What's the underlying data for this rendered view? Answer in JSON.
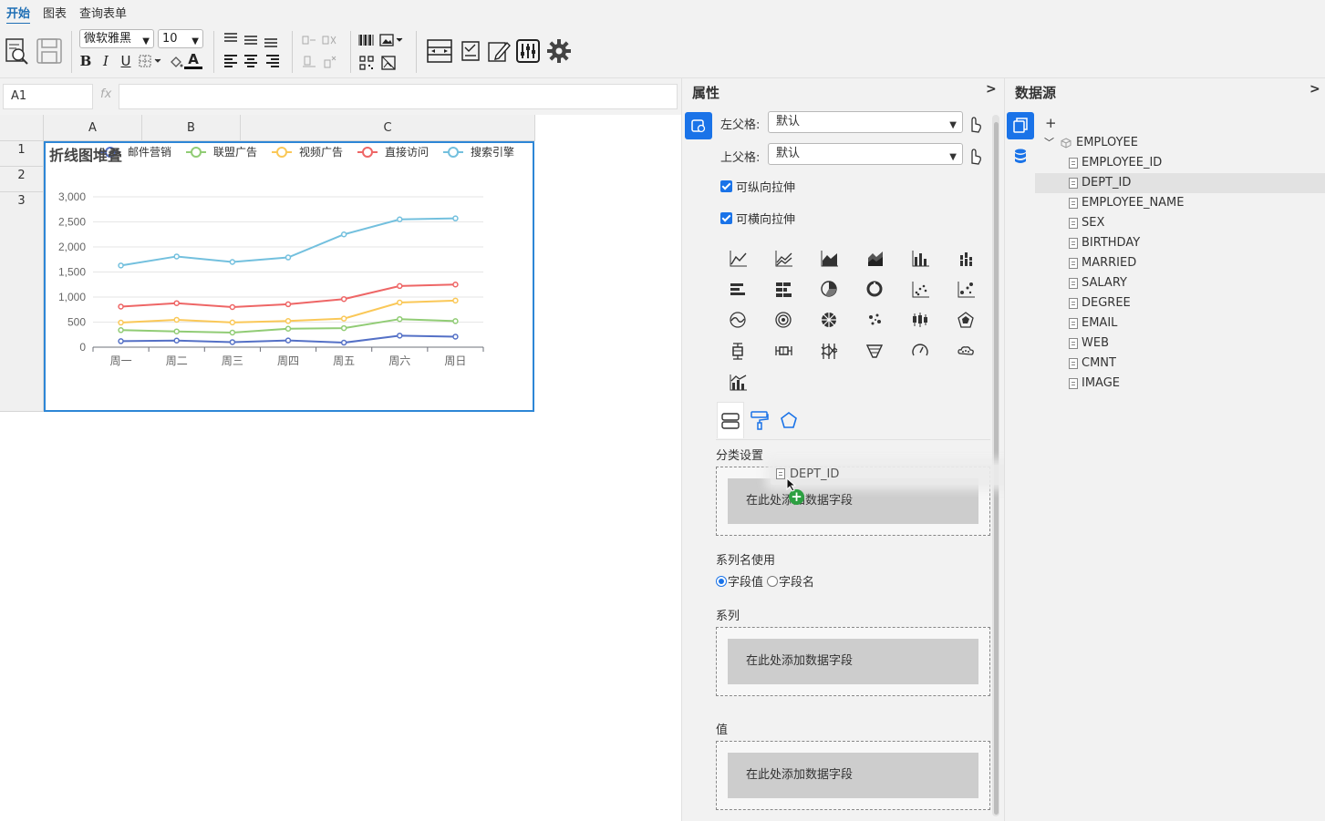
{
  "menu": {
    "tabs": [
      "开始",
      "图表",
      "查询表单"
    ]
  },
  "toolbar": {
    "font_family": "微软雅黑",
    "font_size": "10",
    "bold": "B",
    "italic": "I",
    "underline": "U",
    "font_color": "A"
  },
  "formula": {
    "cell_ref": "A1",
    "fx": "fx",
    "value": ""
  },
  "sheet": {
    "columns": [
      "A",
      "B",
      "C"
    ],
    "rows": [
      "1",
      "2",
      "3"
    ]
  },
  "chart_data": {
    "type": "line",
    "title": "折线图堆叠",
    "categories": [
      "周一",
      "周二",
      "周三",
      "周四",
      "周五",
      "周六",
      "周日"
    ],
    "ylim": [
      0,
      3000
    ],
    "yticks": [
      "3,000",
      "2,500",
      "2,000",
      "1,500",
      "1,000",
      "500",
      "0"
    ],
    "grid": true,
    "legend_position": "top",
    "series": [
      {
        "name": "邮件营销",
        "color": "#5470c6",
        "values": [
          120,
          132,
          101,
          134,
          90,
          230,
          210
        ]
      },
      {
        "name": "联盟广告",
        "color": "#91cc75",
        "values": [
          340,
          314,
          292,
          368,
          380,
          560,
          520
        ]
      },
      {
        "name": "视频广告",
        "color": "#fac858",
        "values": [
          490,
          546,
          493,
          522,
          570,
          890,
          930
        ]
      },
      {
        "name": "直接访问",
        "color": "#ee6666",
        "values": [
          810,
          878,
          800,
          856,
          960,
          1220,
          1250
        ]
      },
      {
        "name": "搜索引擎",
        "color": "#73c0de",
        "values": [
          1630,
          1810,
          1700,
          1790,
          2250,
          2550,
          2570
        ]
      }
    ]
  },
  "properties": {
    "title": "属性",
    "collapse": ">",
    "left_parent_label": "左父格:",
    "left_parent_value": "默认",
    "top_parent_label": "上父格:",
    "top_parent_value": "默认",
    "vertical_stretch": "可纵向拉伸",
    "horizontal_stretch": "可横向拉伸",
    "category_label": "分类设置",
    "category_placeholder": "在此处添加数据字段",
    "series_name_label": "系列名使用",
    "series_name_opt1": "字段值",
    "series_name_opt2": "字段名",
    "series_label": "系列",
    "series_placeholder": "在此处添加数据字段",
    "value_label": "值",
    "value_placeholder": "在此处添加数据字段",
    "drag_ghost": "DEPT_ID"
  },
  "datasource": {
    "title": "数据源",
    "collapse": ">",
    "add": "+",
    "table": "EMPLOYEE",
    "fields": [
      "EMPLOYEE_ID",
      "DEPT_ID",
      "EMPLOYEE_NAME",
      "SEX",
      "BIRTHDAY",
      "MARRIED",
      "SALARY",
      "DEGREE",
      "EMAIL",
      "WEB",
      "CMNT",
      "IMAGE"
    ],
    "selected_field": "DEPT_ID"
  },
  "colors": {
    "accent": "#1a73e8",
    "selection": "#2d86d6"
  }
}
